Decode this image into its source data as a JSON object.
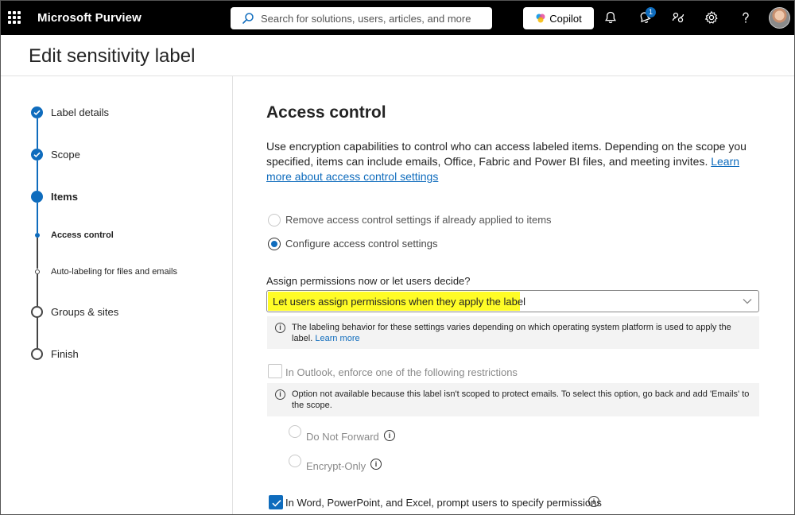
{
  "app": {
    "name": "Microsoft Purview"
  },
  "search": {
    "placeholder": "Search for solutions, users, articles, and more"
  },
  "topbar": {
    "copilot_label": "Copilot",
    "notification_count": "1"
  },
  "page": {
    "title": "Edit sensitivity label"
  },
  "steps": [
    {
      "label": "Label details",
      "state": "done"
    },
    {
      "label": "Scope",
      "state": "done"
    },
    {
      "label": "Items",
      "state": "current"
    },
    {
      "label": "Access control",
      "state": "current-sub"
    },
    {
      "label": "Auto-labeling for files and emails",
      "state": "upcoming-sub"
    },
    {
      "label": "Groups & sites",
      "state": "upcoming"
    },
    {
      "label": "Finish",
      "state": "upcoming"
    }
  ],
  "main": {
    "title": "Access control",
    "description": "Use encryption capabilities to control who can access labeled items. Depending on the scope you specified, items can include emails, Office, Fabric and Power BI files, and meeting invites.",
    "learn_more_link": "Learn more about access control settings",
    "options": {
      "remove": "Remove access control settings if already applied to items",
      "configure": "Configure access control settings",
      "selected": "configure"
    },
    "assign_label": "Assign permissions now or let users decide?",
    "assign_value": "Let users assign permissions when they apply the label",
    "info1_text": "The labeling behavior for these settings varies depending on which operating system platform is used to apply the label.",
    "info1_link": "Learn more",
    "outlook_label": "In Outlook, enforce one of the following restrictions",
    "info2_text": "Option not available because this label isn't scoped to protect emails. To select this option, go back and add 'Emails' to the scope.",
    "do_not_forward": "Do Not Forward",
    "encrypt_only": "Encrypt-Only",
    "office_prompt_label": "In Word, PowerPoint, and Excel, prompt users to specify permissions",
    "office_prompt_checked": true
  },
  "colors": {
    "accent": "#0f6cbd",
    "highlight": "#fffb00",
    "topbar": "#000000"
  }
}
